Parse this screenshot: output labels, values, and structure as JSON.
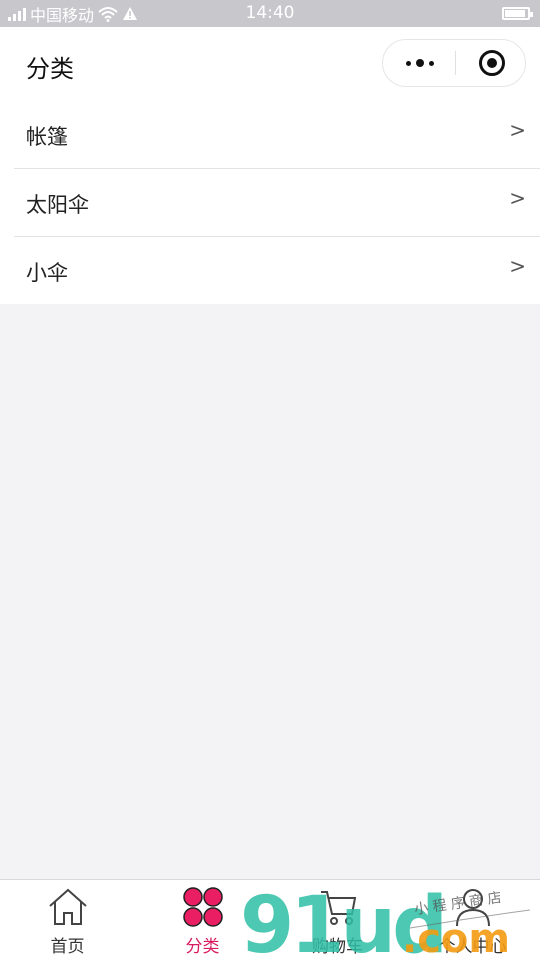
{
  "status_bar": {
    "carrier": "中国移动",
    "time": "14:40"
  },
  "nav": {
    "title": "分类"
  },
  "categories": [
    {
      "label": "帐篷",
      "arrow": ">"
    },
    {
      "label": "太阳伞",
      "arrow": ">"
    },
    {
      "label": "小伞",
      "arrow": ">"
    }
  ],
  "tabs": [
    {
      "label": "首页",
      "icon": "home-icon"
    },
    {
      "label": "分类",
      "icon": "category-icon",
      "active": true
    },
    {
      "label": "购物车",
      "icon": "cart-icon"
    },
    {
      "label": "个人中心",
      "icon": "user-icon"
    }
  ],
  "watermark": {
    "brand": "91ud.com",
    "tagline": "小程序商店"
  },
  "colors": {
    "accent": "#d81b60",
    "category_icon_fill": "#e91e63",
    "status_bar": "#c8c7cc",
    "page_background": "#f3f2f5",
    "watermark_teal": "#2fbfa5",
    "watermark_orange": "#f39c12"
  }
}
